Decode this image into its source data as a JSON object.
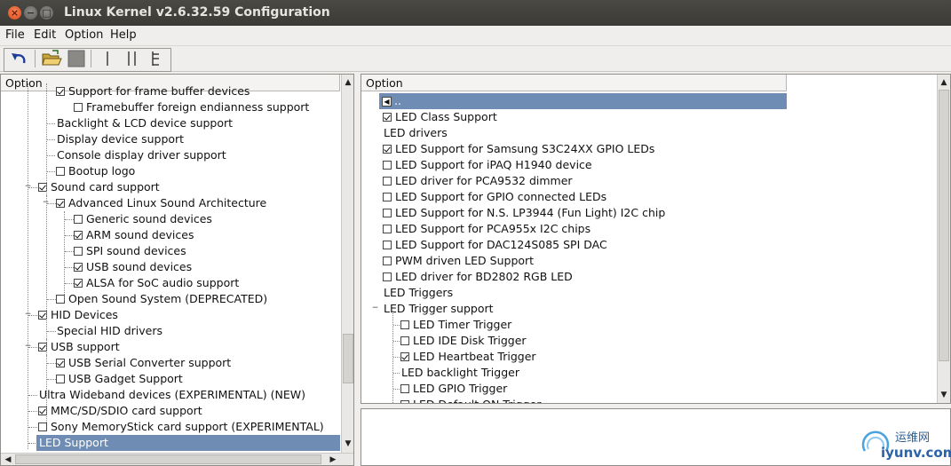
{
  "window": {
    "title": "Linux Kernel v2.6.32.59 Configuration"
  },
  "menu": {
    "items": [
      "File",
      "Edit",
      "Option",
      "Help"
    ]
  },
  "left_pane": {
    "header": "Option",
    "rows": [
      {
        "label": "Support for frame buffer devices",
        "checkbox": true,
        "checked": true
      },
      {
        "label": "Framebuffer foreign endianness support",
        "checkbox": true,
        "checked": false
      },
      {
        "label": "Backlight & LCD device support",
        "checkbox": false
      },
      {
        "label": "Display device support",
        "checkbox": false
      },
      {
        "label": "Console display driver support",
        "checkbox": false
      },
      {
        "label": "Bootup logo",
        "checkbox": true,
        "checked": false
      },
      {
        "label": "Sound card support",
        "checkbox": true,
        "checked": true
      },
      {
        "label": "Advanced Linux Sound Architecture",
        "checkbox": true,
        "checked": true
      },
      {
        "label": "Generic sound devices",
        "checkbox": true,
        "checked": false
      },
      {
        "label": "ARM sound devices",
        "checkbox": true,
        "checked": true
      },
      {
        "label": "SPI sound devices",
        "checkbox": true,
        "checked": false
      },
      {
        "label": "USB sound devices",
        "checkbox": true,
        "checked": true
      },
      {
        "label": "ALSA for SoC audio support",
        "checkbox": true,
        "checked": true
      },
      {
        "label": "Open Sound System (DEPRECATED)",
        "checkbox": true,
        "checked": false
      },
      {
        "label": "HID Devices",
        "checkbox": true,
        "checked": true
      },
      {
        "label": "Special HID drivers",
        "checkbox": false
      },
      {
        "label": "USB support",
        "checkbox": true,
        "checked": true
      },
      {
        "label": "USB Serial Converter support",
        "checkbox": true,
        "checked": true
      },
      {
        "label": "USB Gadget Support",
        "checkbox": true,
        "checked": false
      },
      {
        "label": "Ultra Wideband devices (EXPERIMENTAL) (NEW)",
        "checkbox": false
      },
      {
        "label": "MMC/SD/SDIO card support",
        "checkbox": true,
        "checked": true
      },
      {
        "label": "Sony MemoryStick card support (EXPERIMENTAL)",
        "checkbox": true,
        "checked": false
      },
      {
        "label": "LED Support",
        "checkbox": false,
        "selected": true
      }
    ]
  },
  "right_pane": {
    "header": "Option",
    "parent_label": "..",
    "rows": [
      {
        "label": "LED Class Support",
        "checkbox": true,
        "checked": true
      },
      {
        "label": "LED drivers",
        "checkbox": false
      },
      {
        "label": "LED Support for Samsung S3C24XX GPIO LEDs",
        "checkbox": true,
        "checked": true
      },
      {
        "label": "LED Support for iPAQ H1940 device",
        "checkbox": true,
        "checked": false
      },
      {
        "label": "LED driver for PCA9532 dimmer",
        "checkbox": true,
        "checked": false
      },
      {
        "label": "LED Support for GPIO connected LEDs",
        "checkbox": true,
        "checked": false
      },
      {
        "label": "LED Support for N.S. LP3944 (Fun Light) I2C chip",
        "checkbox": true,
        "checked": false
      },
      {
        "label": "LED Support for PCA955x I2C chips",
        "checkbox": true,
        "checked": false
      },
      {
        "label": "LED Support for DAC124S085 SPI DAC",
        "checkbox": true,
        "checked": false
      },
      {
        "label": "PWM driven LED Support",
        "checkbox": true,
        "checked": false
      },
      {
        "label": "LED driver for BD2802 RGB LED",
        "checkbox": true,
        "checked": false
      },
      {
        "label": "LED Triggers",
        "checkbox": false
      },
      {
        "label": "LED Trigger support",
        "checkbox": false
      },
      {
        "label": "LED Timer Trigger",
        "checkbox": true,
        "checked": false
      },
      {
        "label": "LED IDE Disk Trigger",
        "checkbox": true,
        "checked": false
      },
      {
        "label": "LED Heartbeat Trigger",
        "checkbox": true,
        "checked": true
      },
      {
        "label": "LED backlight Trigger",
        "checkbox": false
      },
      {
        "label": "LED GPIO Trigger",
        "checkbox": true,
        "checked": false
      },
      {
        "label": "LED Default ON Trigger",
        "checkbox": true,
        "checked": false
      }
    ]
  },
  "watermark": {
    "line1": "运维网",
    "line2": "iyunv.com"
  },
  "colors": {
    "selection": "#6f8db4",
    "titlebar": "#3c3b37",
    "close_button": "#e95420"
  }
}
